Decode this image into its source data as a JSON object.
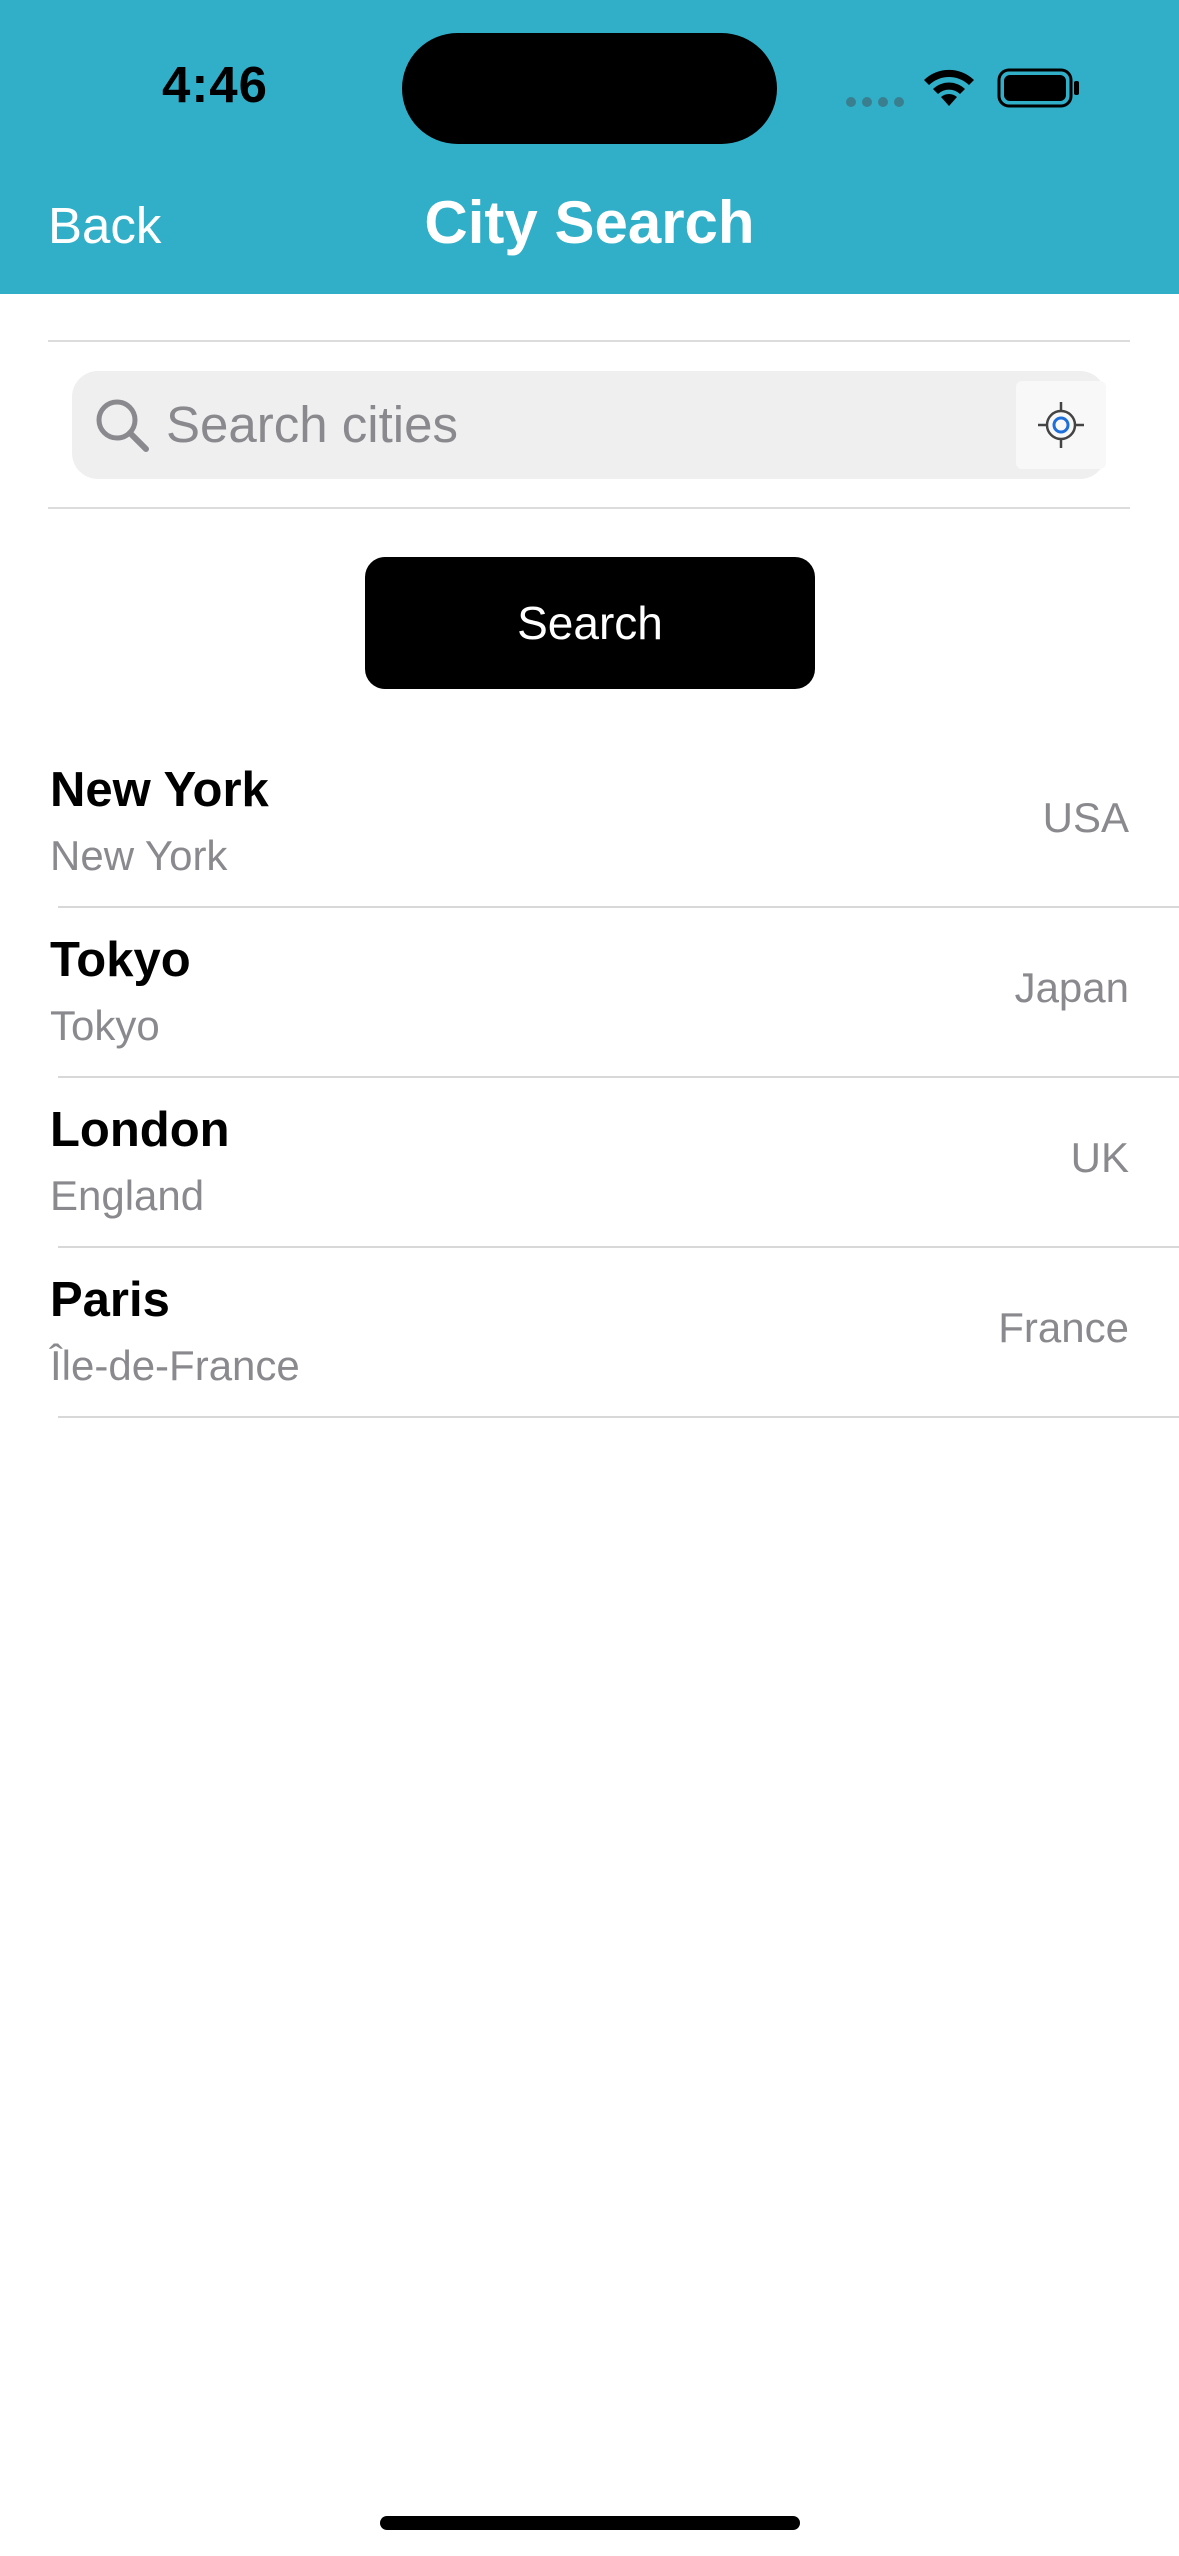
{
  "status_bar": {
    "time": "4:46"
  },
  "nav": {
    "back_label": "Back",
    "title": "City Search"
  },
  "search": {
    "placeholder": "Search cities",
    "button_label": "Search"
  },
  "cities": [
    {
      "name": "New York",
      "region": "New York",
      "country": "USA"
    },
    {
      "name": "Tokyo",
      "region": "Tokyo",
      "country": "Japan"
    },
    {
      "name": "London",
      "region": "England",
      "country": "UK"
    },
    {
      "name": "Paris",
      "region": "Île-de-France",
      "country": "France"
    }
  ],
  "colors": {
    "header_background": "#31AFC8",
    "search_field_background": "#EFEFF0",
    "secondary_text": "#8A8A8E",
    "button_background": "#000000",
    "location_accent": "#1E6FD9"
  },
  "icons": {
    "search": "search-icon",
    "location": "location-crosshair-icon",
    "wifi": "wifi-icon",
    "battery": "battery-icon",
    "signal": "cellular-signal-icon"
  }
}
